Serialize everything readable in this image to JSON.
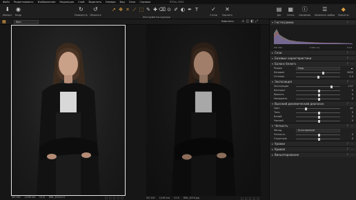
{
  "app": {
    "title": "RTStv-2020"
  },
  "menu": [
    "Файл",
    "Редактировать",
    "Изображение",
    "Коррекция",
    "Слой",
    "Выделить",
    "Камера",
    "Вид",
    "Окно",
    "Справка"
  ],
  "toolbar": {
    "import_label": "Импорт",
    "capture_label": "Кадр",
    "rotate_label": "Повернуть",
    "reset_label": "Сбросить",
    "cursor_tools_label": "Инструменты курсора",
    "styles_label": "Стили",
    "delete_label": "Удалить",
    "right_buttons": [
      {
        "label": "Дж",
        "icon": "export-icon"
      },
      {
        "label": "Сетка",
        "icon": "grid-icon"
      },
      {
        "label": "Сведения",
        "icon": "info-icon"
      },
      {
        "label": "Изменить выбор",
        "icon": "select-icon"
      },
      {
        "label": "Пресеты",
        "icon": "presets-icon"
      }
    ]
  },
  "subbar": {
    "collection": "Фон",
    "zoom": "Уместить"
  },
  "viewer": {
    "left": {
      "iso": "ISO 200",
      "shutter": "1/160 сек",
      "aperture": "f/1.8",
      "filename": "DWL_6216.cr3"
    },
    "right": {
      "iso": "ISO 200",
      "shutter": "1/160 сек",
      "aperture": "f/1.8",
      "filename": "DWL_6216.jpg"
    }
  },
  "panel": {
    "histogram": {
      "title": "Гистограмма",
      "iso": "ISO 200",
      "shutter": "1/160 сек",
      "aperture": "f/1.8"
    },
    "layers_title": "Слои",
    "base_title": "Базовые характеристики",
    "wb": {
      "title": "Баланс белого",
      "mode_label": "Режим",
      "mode_value": "Кадр",
      "kelvin_label": "Кельвин",
      "kelvin_value": "6405",
      "tint_label": "Оттенок",
      "tint_value": "-1.4",
      "kelvin_level": 0.6,
      "tint_level": 0.48
    },
    "exposure": {
      "title": "Экспозиция",
      "rows": [
        {
          "label": "Экспозиция",
          "value": "2.57",
          "level": 0.78
        },
        {
          "label": "Контраст",
          "value": "0",
          "level": 0.5
        },
        {
          "label": "Яркость",
          "value": "0",
          "level": 0.5
        },
        {
          "label": "Насыщенн.",
          "value": "0",
          "level": 0.5
        }
      ]
    },
    "hdr": {
      "title": "Высокий динамический диапазон",
      "rows": [
        {
          "label": "Свет",
          "value": "-61",
          "level": 0.2
        },
        {
          "label": "Тени",
          "value": "0",
          "level": 0.5
        },
        {
          "label": "Белый",
          "value": "0",
          "level": 0.5
        },
        {
          "label": "Черный",
          "value": "0",
          "level": 0.5
        }
      ]
    },
    "clarity": {
      "title": "Четкость",
      "method_label": "Метод",
      "method_value": "Естественный",
      "rows": [
        {
          "label": "Четкость",
          "value": "0",
          "level": 0.5
        },
        {
          "label": "Структура",
          "value": "0",
          "level": 0.5
        }
      ]
    },
    "levels_title": "Уровни",
    "curves_title": "Кривая",
    "vignette_title": "Виньетирование"
  },
  "colors": {
    "accent": "#e0a040",
    "panel": "#202020",
    "header": "#262626"
  }
}
